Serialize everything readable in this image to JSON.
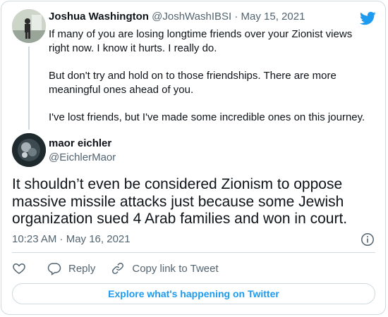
{
  "brand_color": "#1d9bf0",
  "parent_tweet": {
    "author_name": "Joshua Washington",
    "author_handle": "@JoshWashIBSI",
    "separator": "·",
    "date": "May 15, 2021",
    "paragraphs": [
      "If many of you are losing longtime friends over your Zionist views right now. I know it hurts. I really do.",
      "But don't try and hold on to those friendships. There are more meaningful ones ahead of you.",
      "I've lost friends, but I've made some incredible ones on this journey."
    ],
    "avatar_icon": "profile-photo-icon"
  },
  "reply_tweet": {
    "author_name": "maor eichler",
    "author_handle": "@EichlerMaor",
    "text": "It shouldn’t even be considered Zionism to oppose massive missile attacks just because some Jewish organization sued 4 Arab families and won in court.",
    "timestamp": "10:23 AM · May 16, 2021",
    "avatar_icon": "profile-photo-icon"
  },
  "actions": {
    "like_icon": "heart-icon",
    "reply_label": "Reply",
    "reply_icon": "speech-bubble-icon",
    "copy_label": "Copy link to Tweet",
    "copy_icon": "link-icon"
  },
  "info_icon": "info-icon",
  "logo_icon": "twitter-bird-icon",
  "explore_label": "Explore what's happening on Twitter"
}
